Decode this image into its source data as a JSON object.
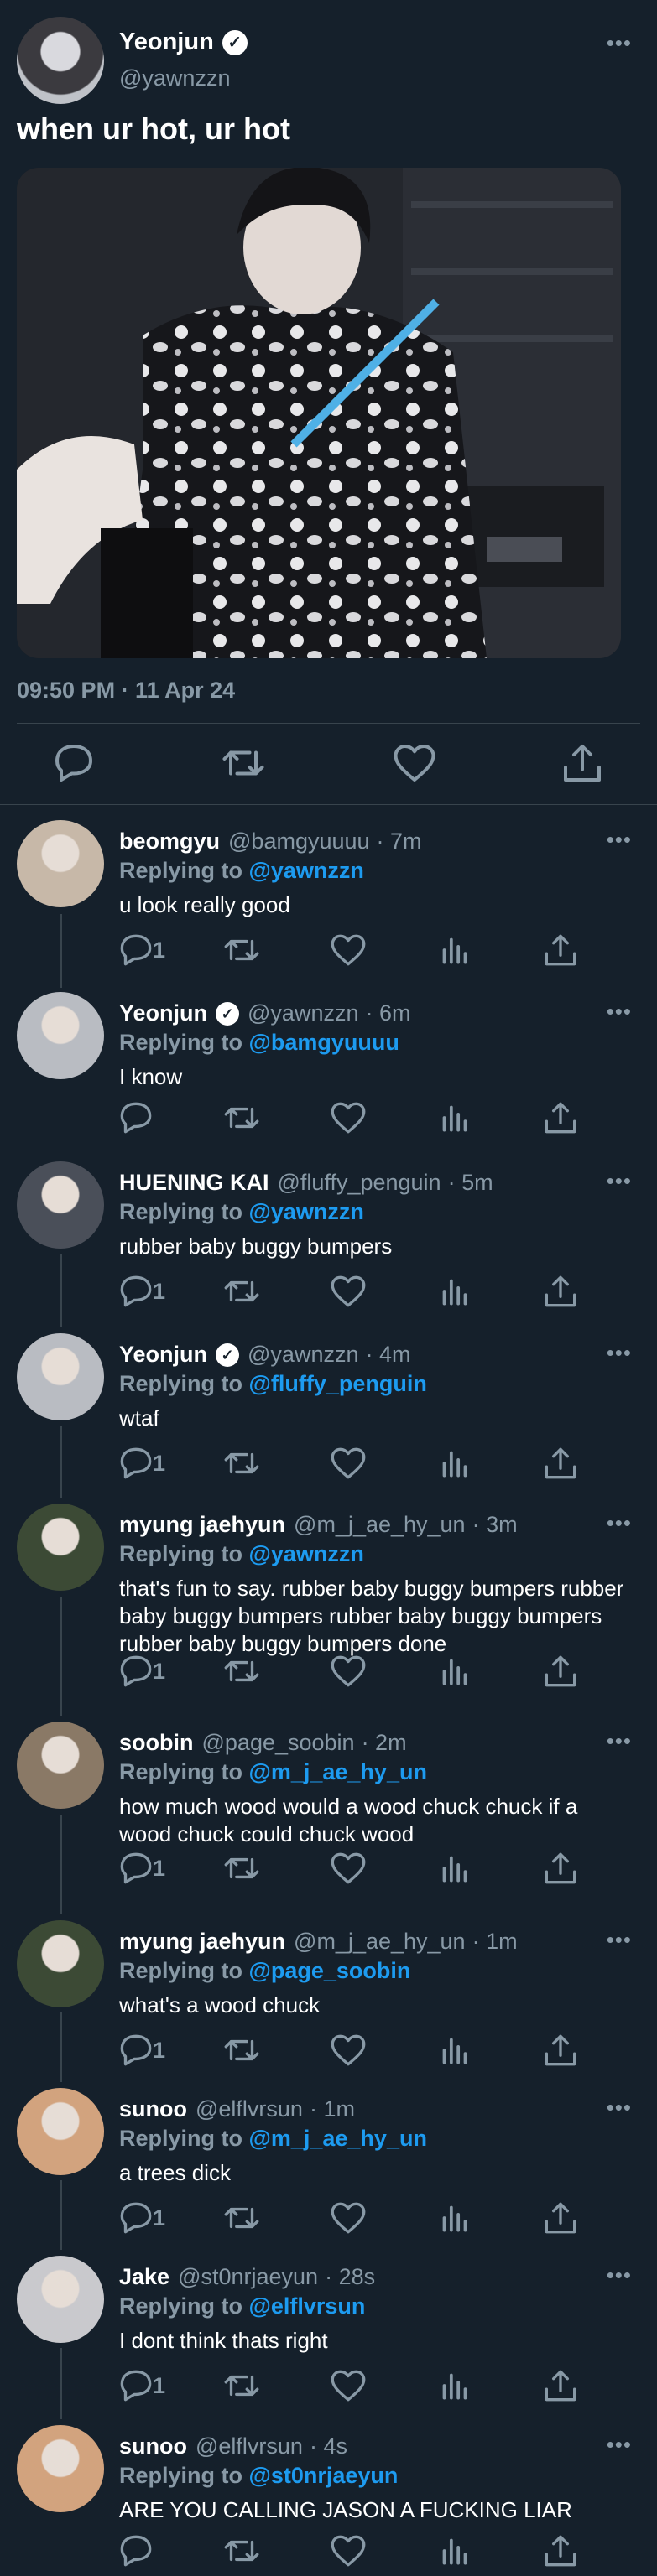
{
  "main_tweet": {
    "name": "Yeonjun",
    "handle": "@yawnzzn",
    "text": "when ur hot, ur hot",
    "timestamp": "09:50 PM · 11 Apr 24",
    "more_icon": "more-horizontal-icon"
  },
  "replies": [
    {
      "name": "beomgyu",
      "handle": "@bamgyuuuu",
      "time": "· 7m",
      "replying_prefix": "Replying to",
      "replying_to": "@yawnzzn",
      "text": "u look really good",
      "reply_count": "1",
      "verified": false,
      "avatar_color": "#c7b8a8"
    },
    {
      "name": "Yeonjun",
      "handle": "@yawnzzn",
      "time": "· 6m",
      "replying_prefix": "Replying to",
      "replying_to": "@bamgyuuuu",
      "text": "I know",
      "reply_count": "",
      "verified": true,
      "avatar_color": "#b9bcc2"
    },
    {
      "name": "HUENING KAI",
      "handle": "@fluffy_penguin",
      "time": "· 5m",
      "replying_prefix": "Replying to",
      "replying_to": "@yawnzzn",
      "text": "rubber baby buggy bumpers",
      "reply_count": "1",
      "verified": false,
      "avatar_color": "#4a4f59"
    },
    {
      "name": "Yeonjun",
      "handle": "@yawnzzn",
      "time": "· 4m",
      "replying_prefix": "Replying to",
      "replying_to": "@fluffy_penguin",
      "text": "wtaf",
      "reply_count": "1",
      "verified": true,
      "avatar_color": "#b9bcc2"
    },
    {
      "name": "myung jaehyun",
      "handle": "@m_j_ae_hy_un",
      "time": "· 3m",
      "replying_prefix": "Replying to",
      "replying_to": "@yawnzzn",
      "text": "that's fun to say. rubber baby buggy bumpers rubber baby buggy bumpers rubber baby buggy bumpers rubber baby buggy bumpers done",
      "reply_count": "1",
      "verified": false,
      "avatar_color": "#3c4a35"
    },
    {
      "name": "soobin",
      "handle": "@page_soobin",
      "time": "· 2m",
      "replying_prefix": "Replying to",
      "replying_to": "@m_j_ae_hy_un",
      "text": "how much wood would a wood chuck chuck if a wood chuck could chuck wood",
      "reply_count": "1",
      "verified": false,
      "avatar_color": "#8a7966"
    },
    {
      "name": "myung jaehyun",
      "handle": "@m_j_ae_hy_un",
      "time": "· 1m",
      "replying_prefix": "Replying to",
      "replying_to": "@page_soobin",
      "text": "what's a wood chuck",
      "reply_count": "1",
      "verified": false,
      "avatar_color": "#3c4a35"
    },
    {
      "name": "sunoo",
      "handle": "@elflvrsun",
      "time": "· 1m",
      "replying_prefix": "Replying to",
      "replying_to": "@m_j_ae_hy_un",
      "text": "a trees dick",
      "reply_count": "1",
      "verified": false,
      "avatar_color": "#d2a37e"
    },
    {
      "name": "Jake",
      "handle": "@st0nrjaeyun",
      "time": "· 28s",
      "replying_prefix": "Replying to",
      "replying_to": "@elflvrsun",
      "text": "I dont think thats right",
      "reply_count": "1",
      "verified": false,
      "avatar_color": "#c9c9cd"
    },
    {
      "name": "sunoo",
      "handle": "@elflvrsun",
      "time": "· 4s",
      "replying_prefix": "Replying to",
      "replying_to": "@st0nrjaeyun",
      "text": "ARE YOU CALLING JASON A FUCKING LIAR",
      "reply_count": "",
      "verified": false,
      "avatar_color": "#d2a37e"
    }
  ],
  "icons": {
    "reply": "reply-icon",
    "retweet": "retweet-icon",
    "like": "like-icon",
    "analytics": "analytics-icon",
    "share": "share-icon",
    "more": "more-horizontal-icon",
    "verified": "verified-badge-icon"
  },
  "colors": {
    "background": "#15202b",
    "border": "#38444d",
    "secondary_text": "#8899a6",
    "link": "#1d9bf0"
  }
}
